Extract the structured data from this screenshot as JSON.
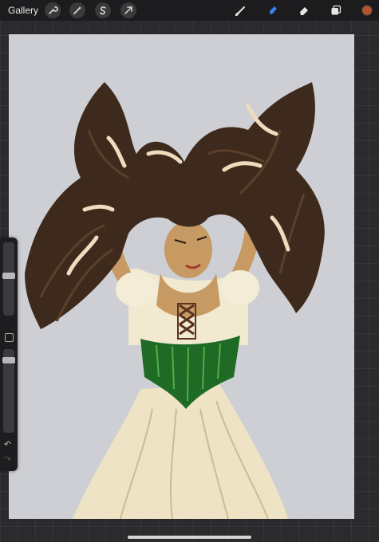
{
  "toolbar": {
    "gallery_label": "Gallery",
    "left_tools": [
      "wrench-icon",
      "magic-wand-icon",
      "selection-s-icon",
      "transform-arrow-icon"
    ],
    "right_tools": [
      "brush-icon",
      "smudge-icon",
      "eraser-icon",
      "layers-icon",
      "color-swatch"
    ],
    "active_tool": "smudge-icon",
    "accent_color": "#3b82f6",
    "current_color": "#b5532b"
  },
  "sidebar": {
    "brush_size_level": 0.55,
    "opacity_level": 0.9,
    "icons": [
      "modify-square-icon",
      "undo-icon",
      "redo-icon"
    ]
  },
  "artwork": {
    "palette": {
      "background": "#cdcfd4",
      "hair": "#3e2a1c",
      "hair_highlight": "#efdcbf",
      "skin": "#c69a62",
      "dress": "#eee3c4",
      "corset": "#1f6b26",
      "lace": "#5a3320"
    }
  }
}
